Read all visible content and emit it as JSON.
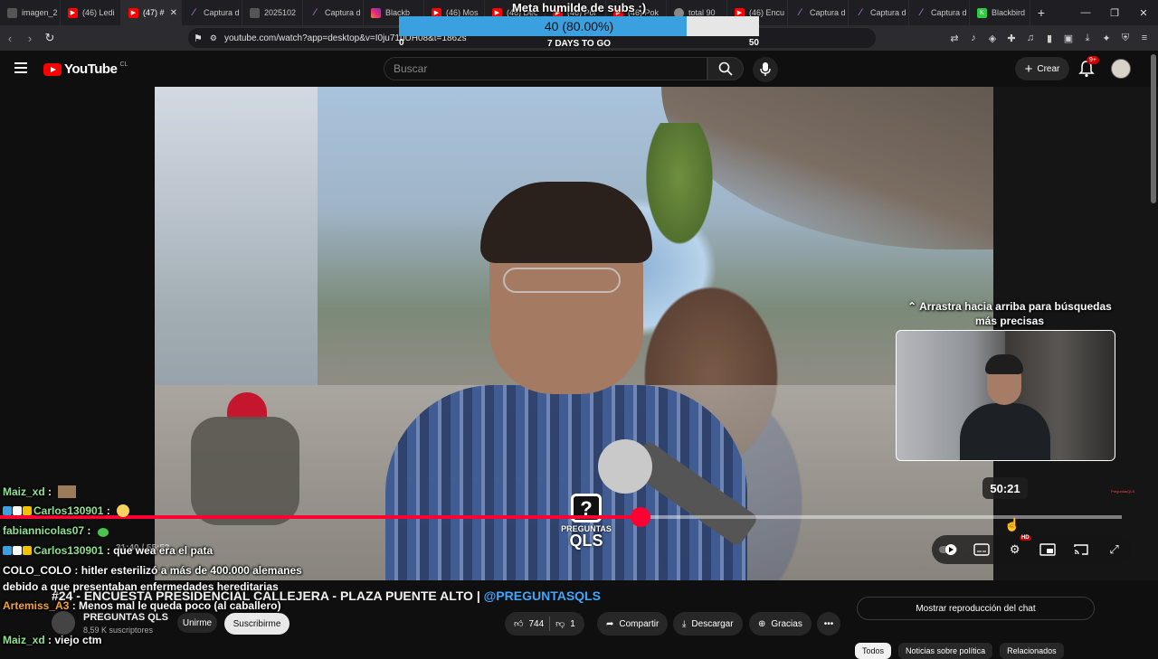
{
  "browser": {
    "tabs": [
      {
        "label": "imagen_2",
        "icon": "image-icon"
      },
      {
        "label": "(46) Ledi",
        "icon": "youtube-icon"
      },
      {
        "label": "(47) #",
        "icon": "youtube-icon",
        "active": true
      },
      {
        "label": "Captura d",
        "icon": "capture-icon"
      },
      {
        "label": "2025102",
        "icon": "document-icon"
      },
      {
        "label": "Captura d",
        "icon": "capture-icon"
      },
      {
        "label": "Blackb",
        "icon": "instagram-icon"
      },
      {
        "label": "(46) Mos",
        "icon": "youtube-icon"
      },
      {
        "label": "(46) Dec",
        "icon": "youtube-icon"
      },
      {
        "label": "(46) Pol",
        "icon": "youtube-icon"
      },
      {
        "label": "(46) Pok",
        "icon": "youtube-icon"
      },
      {
        "label": "total 90",
        "icon": "pokemon-icon"
      },
      {
        "label": "(46) Encu",
        "icon": "youtube-icon"
      },
      {
        "label": "Captura d",
        "icon": "capture-icon"
      },
      {
        "label": "Captura d",
        "icon": "capture-icon"
      },
      {
        "label": "Captura d",
        "icon": "capture-icon"
      },
      {
        "label": "Blackbird",
        "icon": "blackbird-icon"
      }
    ],
    "url": "youtube.com/watch?app=desktop&v=I0ju71uUH08&t=1862s"
  },
  "subgoal": {
    "title": "Meta humilde de subs :)",
    "progress_text": "40 (80.00%)",
    "progress_fraction": 0.8,
    "min": "0",
    "days": "7 DAYS TO GO",
    "max": "50"
  },
  "youtube": {
    "logo_text": "YouTube",
    "country": "CL",
    "search_placeholder": "Buscar",
    "create_label": "Crear",
    "notif_badge": "9+"
  },
  "player": {
    "drag_hint": "Arrastra hacia arriba para búsquedas más precisas",
    "hover_time": "50:21",
    "played_fraction": 0.571,
    "hover_fraction": 0.897,
    "time_display": "31:40 / 55:53",
    "logo_line1": "PREGUNTAS",
    "logo_line2": "QLS",
    "logo_glyph": "?",
    "hd_badge": "HD",
    "watermark": "PreguntasQLS"
  },
  "video": {
    "title_tag": "#24 - ",
    "title_main": "ENCUESTA PRESIDENCIAL CALLEJERA - PLAZA PUENTE ALTO | ",
    "title_handle": "@PREGUNTASQLS",
    "channel": "PREGUNTAS QLS",
    "subs": "8,59 K suscriptores",
    "join": "Unirme",
    "subscribe": "Suscribirme",
    "likes": "744",
    "dislikes": "1",
    "share": "Compartir",
    "download": "Descargar",
    "thanks": "Gracias",
    "show_chat_replay": "Mostrar reproducción del chat",
    "chips": [
      "Todos",
      "Noticias sobre política",
      "Relacionados"
    ]
  },
  "chat": [
    {
      "user": "Maiz_xd",
      "text": "",
      "color": "#8fe38f"
    },
    {
      "user": "Carlos130901",
      "text": "",
      "color": "#8fe38f"
    },
    {
      "user": "fabiannicolas07",
      "text": "",
      "color": "#8fe38f"
    },
    {
      "user": "Carlos130901",
      "text": "que wea era el pata",
      "color": "#8fe38f"
    },
    {
      "user": "COLO_COLO",
      "text": "hitler esterilizó a más de 400.000 alemanes",
      "color": "#ffffff"
    },
    {
      "user": "",
      "text": "debido a que presentaban enfermedades hereditarias",
      "color": "#ffffff"
    },
    {
      "user": "Artemiss_A3",
      "text": "Menos mal le queda poco (al caballero)",
      "color": "#f2a23a"
    },
    {
      "user": "Maiz_xd",
      "text": "viejo ctm",
      "color": "#8fe38f"
    }
  ]
}
